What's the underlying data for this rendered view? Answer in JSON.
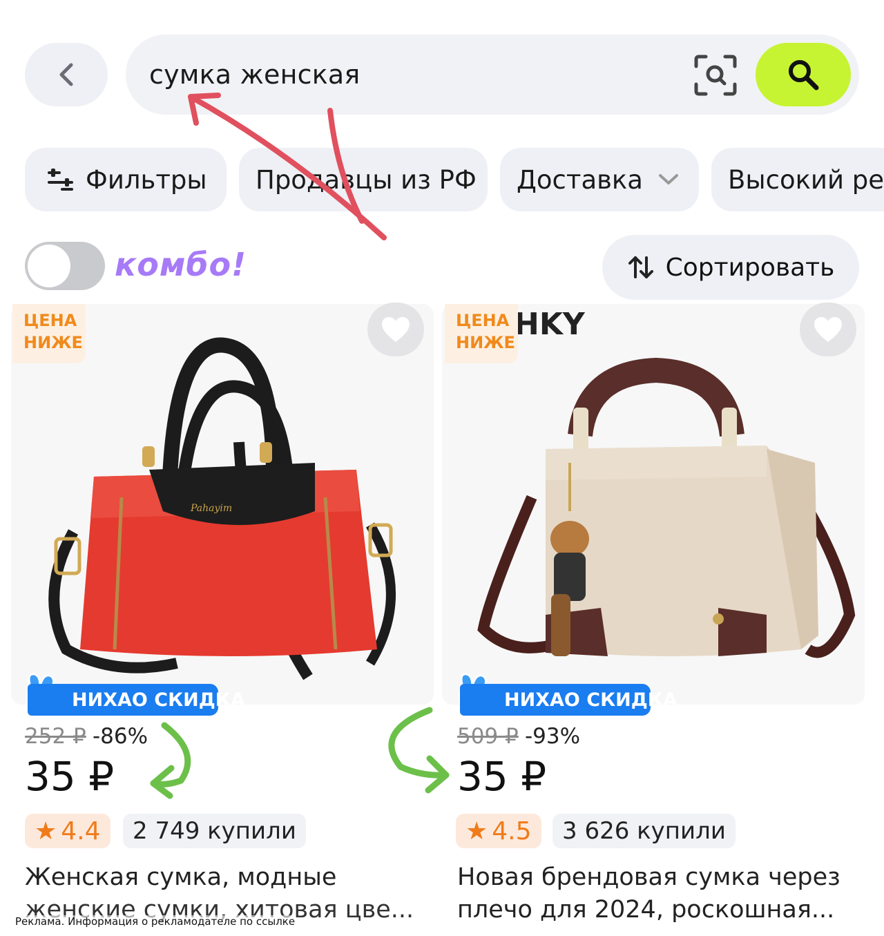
{
  "search": {
    "query": "сумка женская"
  },
  "chips": {
    "filters": "Фильтры",
    "sellers_rf": "Продавцы из РФ",
    "delivery": "Доставка",
    "high_rating": "Высокий рей"
  },
  "combo": {
    "label": "комбо!",
    "toggle_on": false
  },
  "sort": {
    "label": "Сортировать"
  },
  "products": [
    {
      "badge": "ЦЕНА\nНИЖЕ",
      "badge_line1": "ЦЕНА",
      "badge_line2": "НИЖЕ",
      "promo": "НИХАО СКИДКА",
      "old_price": "252 ₽",
      "discount": "-86%",
      "price": "35 ₽",
      "rating": "4.4",
      "bought": "2 749 купили",
      "title_line1": "Женская сумка, модные",
      "title_line2": "женские сумки, хитовая цве..."
    },
    {
      "badge_line1": "ЦЕНА",
      "badge_line2": "НИЖЕ",
      "brand_fragment": "HKY",
      "promo": "НИХАО СКИДКА",
      "old_price": "509 ₽",
      "discount": "-93%",
      "price": "35 ₽",
      "rating": "4.5",
      "bought": "3 626 купили",
      "title_line1": "Новая брендовая сумка через",
      "title_line2": "плечо для 2024, роскошная..."
    }
  ],
  "ad_note": "Реклама. Информация о рекламодателе по ссылке",
  "colors": {
    "search_button": "#c6f432",
    "promo_blue": "#1a7df0",
    "price_badge_orange": "#f08a1c",
    "combo_purple": "#a77af7",
    "annotation_red": "#e0505e",
    "annotation_green": "#6cc04a"
  }
}
